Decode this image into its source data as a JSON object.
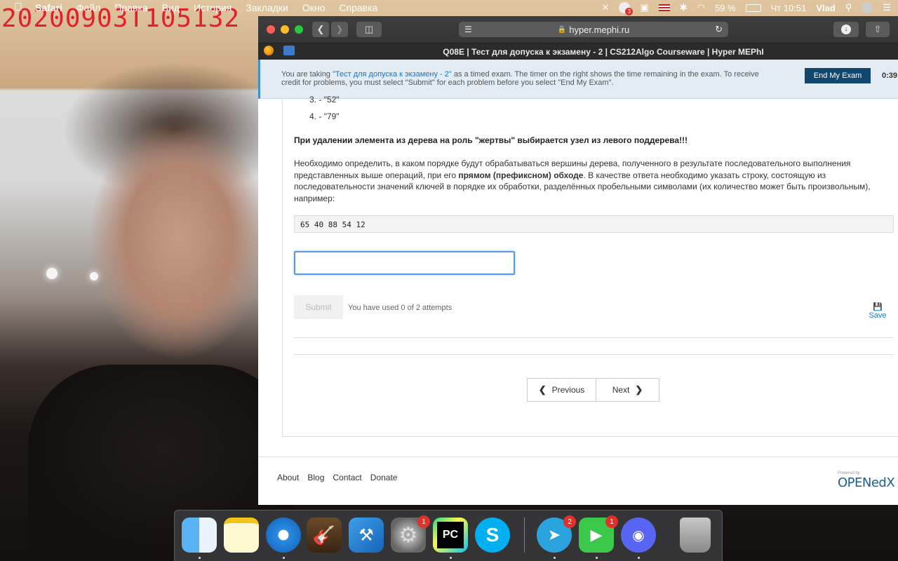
{
  "webcam": {
    "timestamp": "20200903T105132"
  },
  "menubar": {
    "apple": "",
    "items": [
      "Safari",
      "Файл",
      "Правка",
      "Вид",
      "История",
      "Закладки",
      "Окно",
      "Справка"
    ],
    "battery": "59 %",
    "clock": "Чт 10:51",
    "user": "Vlad",
    "mail_badge": "3"
  },
  "browser": {
    "url": "hyper.mephi.ru",
    "tab_title": "Q08E | Тест для допуска к экзамену - 2 | CS212Algo Courseware | Hyper MEPhI"
  },
  "banner": {
    "text_before": "You are taking ",
    "exam_link": "\"Тест для допуска к экзамену - 2\"",
    "text_after": " as a timed exam. The timer on the right shows the time remaining in the exam. To receive credit for problems, you must select \"Submit\" for each problem before you select \"End My Exam\".",
    "end_button": "End My Exam",
    "timer": "0:39:"
  },
  "problem": {
    "list_items": [
      {
        "num": "3.",
        "text": "- \"52\""
      },
      {
        "num": "4.",
        "text": "- \"79\""
      }
    ],
    "bold_note": "При удалении элемента из дерева на роль \"жертвы\" выбирается узел из левого поддерева!!!",
    "para_1": "Необходимо определить, в каком порядке будут обрабатываться вершины дерева, полученного в результате последовательного выполнения представленных выше операций, при его ",
    "para_bold": "прямом (префиксном) обходе",
    "para_2": ". В качестве ответа необходимо указать строку, состоящую из последовательности значений ключей в порядке их обработки, разделённых пробельными символами (их количество может быть произвольным), например:",
    "example": "65 40 88 54 12",
    "answer_value": "",
    "submit_label": "Submit",
    "attempts": "You have used 0 of 2 attempts",
    "save_label": "Save"
  },
  "navigation": {
    "previous": "Previous",
    "next": "Next"
  },
  "footer": {
    "links": [
      "About",
      "Blog",
      "Contact",
      "Donate"
    ],
    "powered_by": "Powered by",
    "logo": "OPENedX"
  },
  "dock": {
    "apps": [
      {
        "name": "Finder",
        "icon": "finder-icon"
      },
      {
        "name": "Notes",
        "icon": "notes-icon"
      },
      {
        "name": "Safari",
        "icon": "safari-icon"
      },
      {
        "name": "GarageBand",
        "icon": "garageband-icon"
      },
      {
        "name": "Xcode",
        "icon": "xcode-icon"
      },
      {
        "name": "System Preferences",
        "icon": "system-preferences-icon",
        "badge": "1"
      },
      {
        "name": "PyCharm",
        "icon": "pycharm-icon"
      },
      {
        "name": "Skype",
        "icon": "skype-icon"
      },
      {
        "name": "Telegram",
        "icon": "telegram-icon",
        "badge": "2"
      },
      {
        "name": "FaceTime",
        "icon": "facetime-icon",
        "badge": "1"
      },
      {
        "name": "Discord",
        "icon": "discord-icon"
      },
      {
        "name": "Trash",
        "icon": "trash-icon"
      }
    ]
  }
}
